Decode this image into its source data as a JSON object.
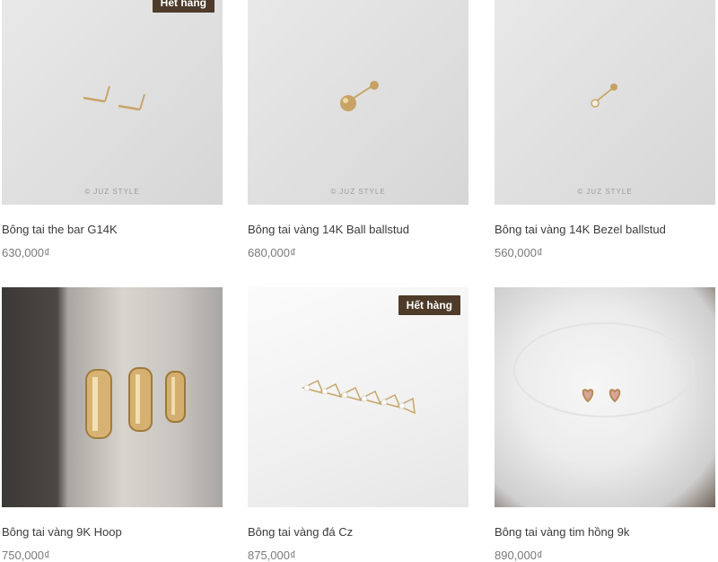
{
  "products": [
    {
      "title": "Bông tai the bar G14K",
      "price": "630,000₫",
      "badge": "Hết hàng",
      "watermark": "© JUZ STYLE"
    },
    {
      "title": "Bông tai vàng 14K Ball ballstud",
      "price": "680,000₫",
      "badge": "",
      "watermark": "© JUZ STYLE"
    },
    {
      "title": "Bông tai vàng 14K Bezel ballstud",
      "price": "560,000₫",
      "badge": "",
      "watermark": "© JUZ STYLE"
    },
    {
      "title": "Bông tai vàng 9K Hoop",
      "price": "750,000₫",
      "badge": "",
      "watermark": ""
    },
    {
      "title": "Bông tai vàng đá Cz",
      "price": "875,000₫",
      "badge": "Hết hàng",
      "watermark": ""
    },
    {
      "title": "Bông tai vàng tim hồng 9k",
      "price": "890,000₫",
      "badge": "",
      "watermark": ""
    }
  ],
  "colors": {
    "badge_bg": "#4e3b29",
    "title": "#3b3b3b",
    "price": "#7a7a7a"
  }
}
